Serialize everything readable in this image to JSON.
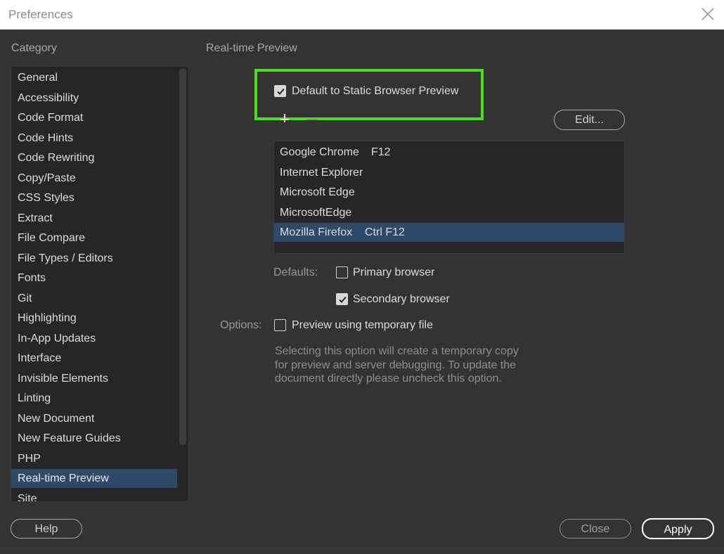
{
  "window": {
    "title": "Preferences"
  },
  "category": {
    "heading": "Category",
    "items": [
      "General",
      "Accessibility",
      "Code Format",
      "Code Hints",
      "Code Rewriting",
      "Copy/Paste",
      "CSS Styles",
      "Extract",
      "File Compare",
      "File Types / Editors",
      "Fonts",
      "Git",
      "Highlighting",
      "In-App Updates",
      "Interface",
      "Invisible Elements",
      "Linting",
      "New Document",
      "New Feature Guides",
      "PHP",
      "Real-time Preview",
      "Site"
    ],
    "selected": "Real-time Preview"
  },
  "panel": {
    "heading": "Real-time Preview",
    "static_preview_label": "Default to Static Browser Preview",
    "static_preview_checked": true,
    "edit_button": "Edit...",
    "browsers": [
      {
        "name": "Google Chrome",
        "key": "F12"
      },
      {
        "name": "Internet Explorer",
        "key": ""
      },
      {
        "name": "Microsoft Edge",
        "key": ""
      },
      {
        "name": "MicrosoftEdge",
        "key": ""
      },
      {
        "name": "Mozilla Firefox",
        "key": "Ctrl F12"
      }
    ],
    "selected_browser": "Mozilla Firefox",
    "defaults_label": "Defaults:",
    "primary_browser_label": "Primary browser",
    "primary_browser_checked": false,
    "secondary_browser_label": "Secondary browser",
    "secondary_browser_checked": true,
    "options_label": "Options:",
    "temp_file_label": "Preview using temporary file",
    "temp_file_checked": false,
    "description_lines": [
      "Selecting this option will create a temporary copy",
      "for preview and server debugging. To update the",
      "document directly please uncheck this option."
    ]
  },
  "footer": {
    "help_button": "Help",
    "close_button": "Close",
    "apply_button": "Apply"
  },
  "colors": {
    "background": "#333333",
    "list_background": "#262626",
    "selection": "#2d4a6b",
    "highlight_box": "#4cdc1f"
  },
  "icons": {
    "close": "close-icon",
    "checkmark": "checkmark-icon",
    "add": "plus-icon",
    "remove": "minus-icon"
  }
}
